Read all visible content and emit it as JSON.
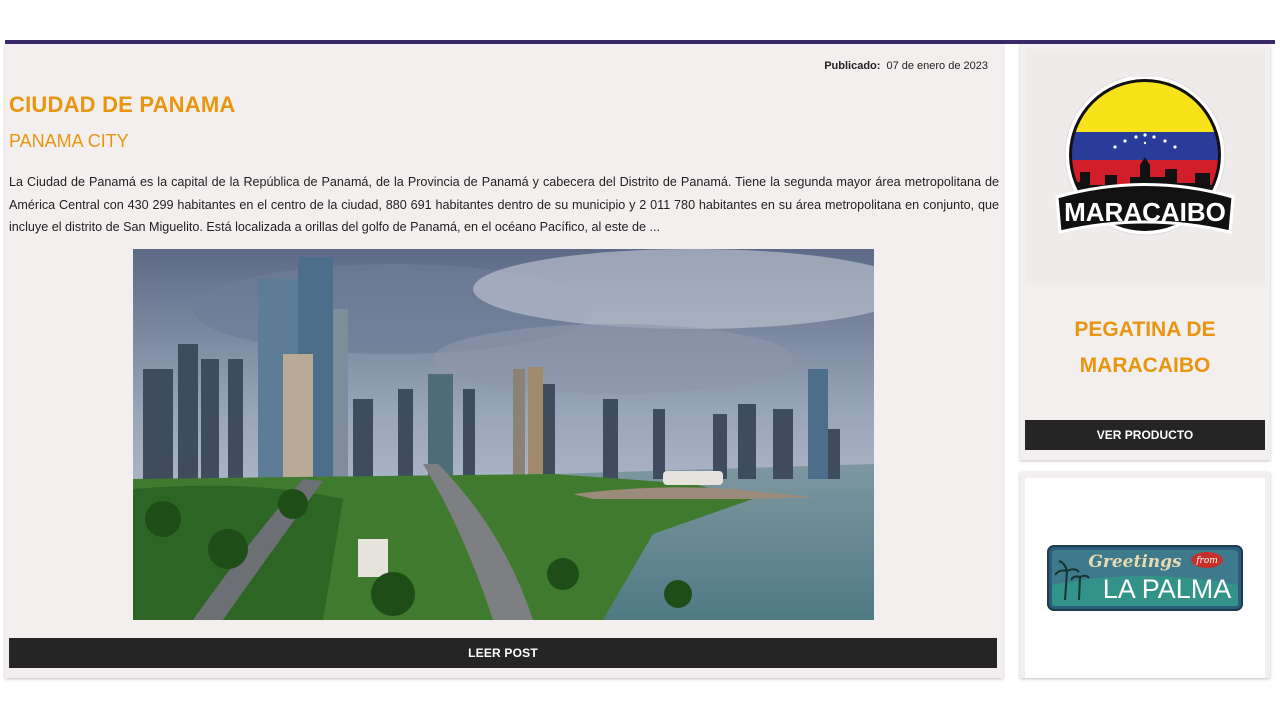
{
  "post": {
    "published_label": "Publicado:",
    "published_date": "07 de enero de 2023",
    "title": "CIUDAD DE PANAMA",
    "subtitle": "PANAMA CITY",
    "excerpt": "La Ciudad de Panamá es la capital de la República de Panamá, de la Provincia de Panamá y cabecera del Distrito de Panamá. Tiene la segunda mayor área metropolitana de América Central con 430 299 habitantes en el centro de la ciudad, 880 691 habitantes dentro de su municipio y 2 011 780 habitantes en su área metropolitana en conjunto, que incluye el distrito de San Miguelito. Está localizada a orillas del golfo de Panamá, en el océano Pacífico, al este de ...",
    "read_button": "LEER POST"
  },
  "sidebar": {
    "product1": {
      "logo_text": "MARACAIBO",
      "title_line1": "PEGATINA DE",
      "title_line2": "MARACAIBO",
      "button": "VER PRODUCTO"
    },
    "product2": {
      "sign_text_script": "Greetings",
      "sign_text_from": "from",
      "sign_text_main": "LA PALMA"
    }
  },
  "colors": {
    "accent": "#e8960f",
    "topbar": "#3b2a6b",
    "button": "#252525",
    "card_bg": "#f2efee"
  }
}
